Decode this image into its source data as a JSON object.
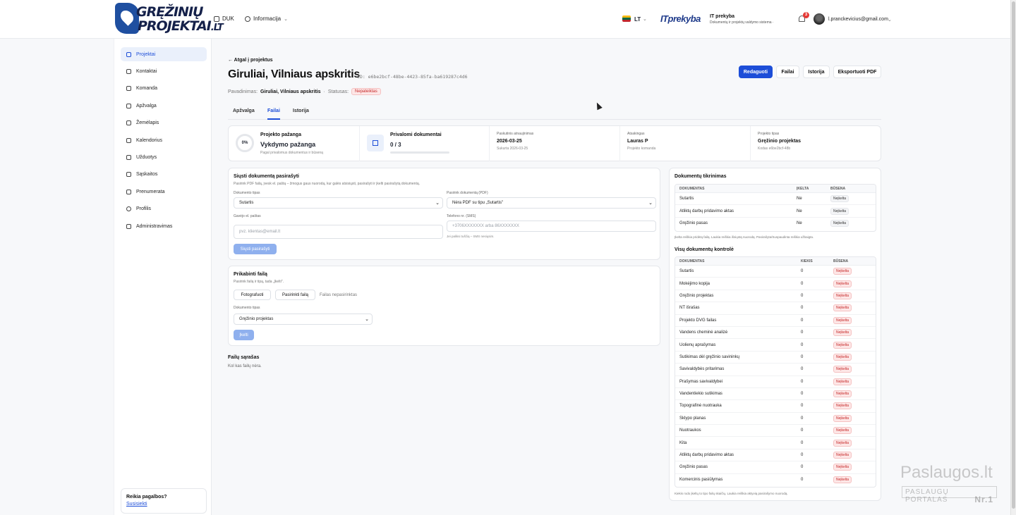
{
  "header": {
    "logo_line1": "GRĘŽINIŲ",
    "logo_line2": "PROJEKTAI",
    "logo_tld": ".LT",
    "nav_faq": "DUK",
    "nav_info": "Informacija",
    "lang": "LT",
    "partner_logo": "ITprekyba",
    "system_name": "IT prekyba",
    "system_sub": "Dokumentų ir projektų valdymo sistema · iTr.p...",
    "notifications": "3",
    "user_email": "l.pranckevicius@gmail.com"
  },
  "sidebar": {
    "items": [
      {
        "label": "Projektai",
        "icon": "folder-icon"
      },
      {
        "label": "Kontaktai",
        "icon": "contacts-icon"
      },
      {
        "label": "Komanda",
        "icon": "team-icon"
      },
      {
        "label": "Apžvalga",
        "icon": "grid-icon"
      },
      {
        "label": "Žemėlapis",
        "icon": "map-icon"
      },
      {
        "label": "Kalendorius",
        "icon": "calendar-icon"
      },
      {
        "label": "Užduotys",
        "icon": "checkbox-icon"
      },
      {
        "label": "Sąskaitos",
        "icon": "invoice-icon"
      },
      {
        "label": "Prenumerata",
        "icon": "card-icon"
      },
      {
        "label": "Profilis",
        "icon": "user-icon"
      },
      {
        "label": "Administravimas",
        "icon": "shield-icon"
      }
    ],
    "help_title": "Reikia pagalbos?",
    "help_link": "Susisiekti"
  },
  "page": {
    "back": "← Atgal į projektus",
    "title": "Giruliai, Vilniaus apskritis",
    "id": "ID: e6be2bcf-48be-4423-85fa-ba619287c4d6",
    "name_label": "Pavadinimas:",
    "name_value": "Giruliai, Vilniaus apskritis",
    "status_label": "Statusas:",
    "status_value": "Nepateiktas",
    "buttons": {
      "edit": "Redaguoti",
      "files": "Failai",
      "history": "Istorija",
      "export": "Eksportuoti PDF"
    },
    "tabs": [
      "Apžvalga",
      "Failai",
      "Istorija"
    ]
  },
  "stats": {
    "progress_pct": "0%",
    "progress_title": "Projekto pažanga",
    "progress_value": "Vykdymo pažanga",
    "progress_sub": "Pagal privalomus dokumentus ir būseną",
    "req_title": "Privalomi dokumentai",
    "req_value": "0 / 3",
    "req_fraction": 0,
    "updated_label": "Paskutinis atnaujinimas",
    "updated_value": "2026-03-25",
    "updated_sub": "Sukurta 2026-03-25",
    "resp_label": "Atsakingas",
    "resp_value": "Lauras P",
    "resp_sub": "Projekto komanda",
    "type_label": "Projekto tipas",
    "type_value": "Gręžinio projektas",
    "type_sub": "Kodas e6be2bcf-48b"
  },
  "send": {
    "title": "Siųsti dokumentą pasirašyti",
    "desc": "Pasirink PDF failą, įvesk el. paštą – žmogus gaus nuorodą, kur galės atsisiųsti, pasirašyti ir įkelti pasirašytą dokumentą.",
    "doc_type_label": "Dokumento tipas",
    "doc_type_value": "Sutartis",
    "pick_label": "Pasirink dokumentą (PDF)",
    "pick_value": "Nėra PDF su tipu „Sutartis\"",
    "email_label": "Gavėjo el. paštas",
    "email_placeholder": "pvz. klientas@email.lt",
    "phone_label": "Telefono nr. (SMS)",
    "phone_placeholder": "+3706XXXXXXX arba 86XXXXXXX",
    "phone_hint": "Jei paliksi tuščią – SMS nesiųsim.",
    "submit": "Siųsti pasirašyti"
  },
  "attach": {
    "title": "Prikabinti failą",
    "desc": "Pasirink failą ir tipą, tada „Įkelti\".",
    "photo_btn": "Fotografuoti",
    "choose_btn": "Pasirinkti failą",
    "no_file": "Failas nepasirinktas",
    "doc_type_label": "Dokumento tipas",
    "doc_type_value": "Gręžinio projektas",
    "upload_btn": "Įkelti"
  },
  "files_list": {
    "title": "Failų sąrašas",
    "empty": "Kol kas failų nėra."
  },
  "check": {
    "title": "Dokumentų tikrinimas",
    "headers": [
      "DOKUMENTAS",
      "ĮKELTA",
      "BŪSENA"
    ],
    "rows": [
      {
        "doc": "Sutartis",
        "uploaded": "Ne",
        "status": "Neįkelta"
      },
      {
        "doc": "Atliktų darbų pridavimo aktas",
        "uploaded": "Ne",
        "status": "Neįkelta"
      },
      {
        "doc": "Gręžinio pasas",
        "uploaded": "Ne",
        "status": "Neįkelta"
      }
    ],
    "note": "Įkelta reiškia pridėtą failą. Laukia reiškia išsiųstą nuorodą. Pasirašyta/Suspaudinta reiškia užbaigta."
  },
  "control": {
    "title": "Visų dokumentų kontrolė",
    "headers": [
      "DOKUMENTAS",
      "KIEKIS",
      "BŪSENA"
    ],
    "rows": [
      {
        "doc": "Sutartis",
        "qty": "0",
        "status": "Neįkelta"
      },
      {
        "doc": "Mokėjimo kopija",
        "qty": "0",
        "status": "Neįkelta"
      },
      {
        "doc": "Gręžinio projektas",
        "qty": "0",
        "status": "Neįkelta"
      },
      {
        "doc": "NT išrašas",
        "qty": "0",
        "status": "Neįkelta"
      },
      {
        "doc": "Projekto DVG failas",
        "qty": "0",
        "status": "Neįkelta"
      },
      {
        "doc": "Vandens cheminė analizė",
        "qty": "0",
        "status": "Neįkelta"
      },
      {
        "doc": "Uolienų aprašymas",
        "qty": "0",
        "status": "Neįkelta"
      },
      {
        "doc": "Sutikimas dėl gręžinio savininkų",
        "qty": "0",
        "status": "Neįkelta"
      },
      {
        "doc": "Savivaldybės pritarimas",
        "qty": "0",
        "status": "Neįkelta"
      },
      {
        "doc": "Prašymas savivaldybei",
        "qty": "0",
        "status": "Neįkelta"
      },
      {
        "doc": "Vandentiekio sutikimas",
        "qty": "0",
        "status": "Neįkelta"
      },
      {
        "doc": "Topografinė nuotrauka",
        "qty": "0",
        "status": "Neįkelta"
      },
      {
        "doc": "Sklypo planas",
        "qty": "0",
        "status": "Neįkelta"
      },
      {
        "doc": "Nuotraukos",
        "qty": "0",
        "status": "Neįkelta"
      },
      {
        "doc": "Kita",
        "qty": "0",
        "status": "Neįkelta"
      },
      {
        "doc": "Atliktų darbų pridavimo aktas",
        "qty": "0",
        "status": "Neįkelta"
      },
      {
        "doc": "Gręžinio pasas",
        "qty": "0",
        "status": "Neįkelta"
      },
      {
        "doc": "Komercinis pasiūlymas",
        "qty": "0",
        "status": "Neįkelta"
      }
    ],
    "note": "Kiekis rodo įkeltų to tipo failų skaičių. Laukia reiškia aktyvią pasirašymo nuorodą."
  },
  "watermark": {
    "line1": "Paslaugos.lt",
    "line2": "PASLAUGŲ PORTALAS",
    "rank": "Nr.1"
  }
}
